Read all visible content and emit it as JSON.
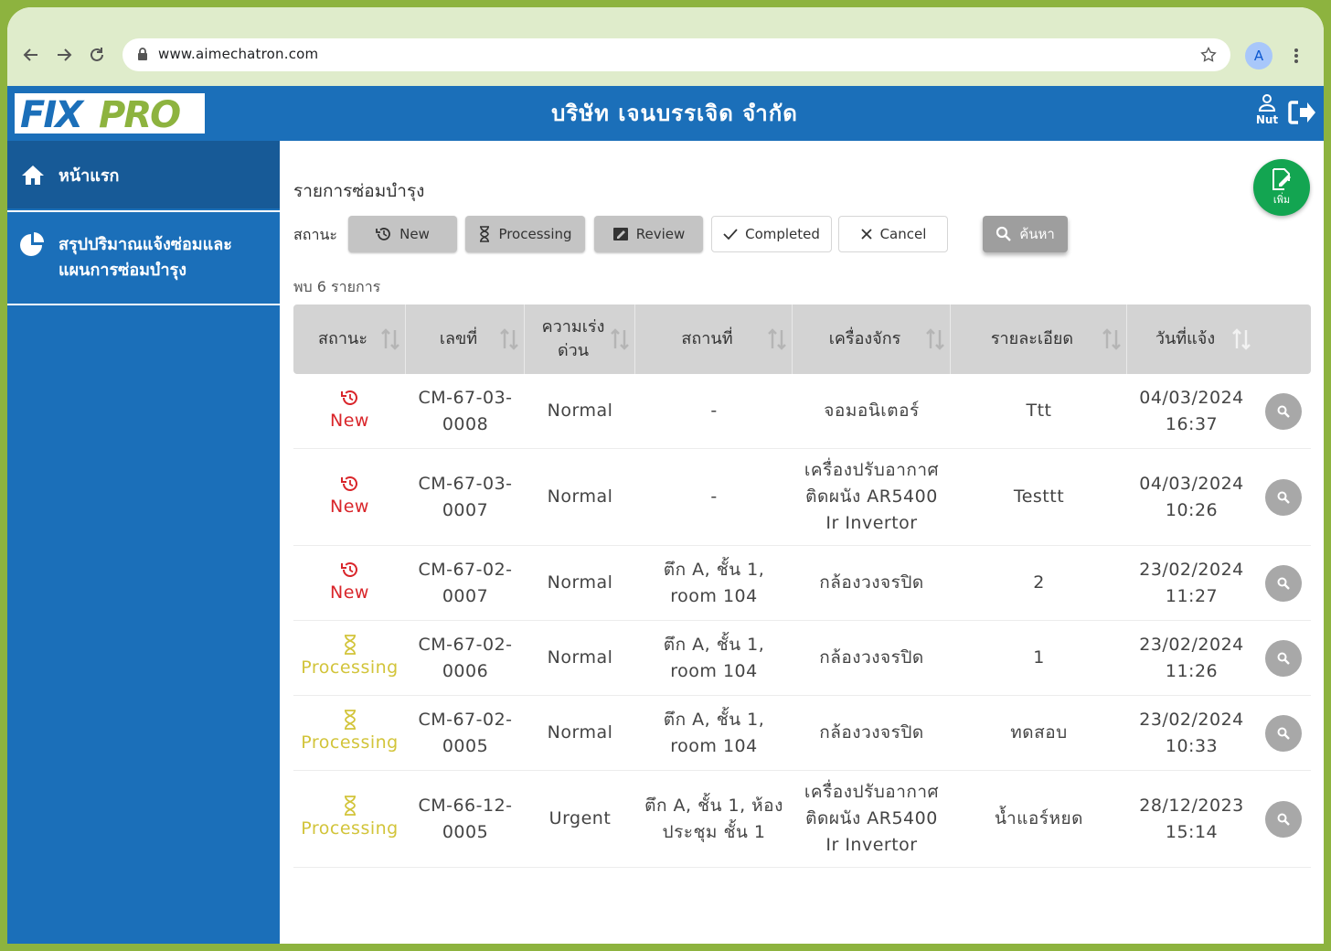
{
  "browser": {
    "url": "www.aimechatron.com",
    "profile_initial": "A"
  },
  "header": {
    "logo_text": "FIXPRO",
    "company": "บริษัท เจนบรรเจิด จำกัด",
    "user_name": "Nut"
  },
  "sidebar": {
    "items": [
      {
        "label": "หน้าแรก",
        "icon": "home-icon"
      },
      {
        "label_line1": "สรุปปริมาณแจ้งซ่อมและ",
        "label_line2": "แผนการซ่อมบำรุง",
        "icon": "pie-chart-icon"
      }
    ]
  },
  "main": {
    "title": "รายการซ่อมบำรุง",
    "status_label": "สถานะ",
    "filters": {
      "new": "New",
      "processing": "Processing",
      "review": "Review",
      "completed": "Completed",
      "cancel": "Cancel",
      "search": "ค้นหา"
    },
    "found_text": "พบ 6 รายการ",
    "add_label": "เพิ่ม",
    "columns": [
      "สถานะ",
      "เลขที่",
      "ความเร่งด่วน",
      "สถานที่",
      "เครื่องจักร",
      "รายละเอียด",
      "วันที่แจ้ง"
    ],
    "column_lines": {
      "urgency_line1": "ความเร่ง",
      "urgency_line2": "ด่วน"
    },
    "rows": [
      {
        "status": "New",
        "no1": "CM-67-03-",
        "no2": "0008",
        "urgency": "Normal",
        "loc1": "-",
        "loc2": "",
        "mach1": "จอมอนิเตอร์",
        "mach2": "",
        "mach3": "",
        "detail": "Ttt",
        "date": "04/03/2024",
        "time": "16:37"
      },
      {
        "status": "New",
        "no1": "CM-67-03-",
        "no2": "0007",
        "urgency": "Normal",
        "loc1": "-",
        "loc2": "",
        "mach1": "เครื่องปรับอากาศ",
        "mach2": "ติดผนัง AR5400",
        "mach3": "Ir Invertor",
        "detail": "Testtt",
        "date": "04/03/2024",
        "time": "10:26"
      },
      {
        "status": "New",
        "no1": "CM-67-02-",
        "no2": "0007",
        "urgency": "Normal",
        "loc1": "ตึก A, ชั้น 1,",
        "loc2": "room 104",
        "mach1": "กล้องวงจรปิด",
        "mach2": "",
        "mach3": "",
        "detail": "2",
        "date": "23/02/2024",
        "time": "11:27"
      },
      {
        "status": "Processing",
        "no1": "CM-67-02-",
        "no2": "0006",
        "urgency": "Normal",
        "loc1": "ตึก A, ชั้น 1,",
        "loc2": "room 104",
        "mach1": "กล้องวงจรปิด",
        "mach2": "",
        "mach3": "",
        "detail": "1",
        "date": "23/02/2024",
        "time": "11:26"
      },
      {
        "status": "Processing",
        "no1": "CM-67-02-",
        "no2": "0005",
        "urgency": "Normal",
        "loc1": "ตึก A, ชั้น 1,",
        "loc2": "room 104",
        "mach1": "กล้องวงจรปิด",
        "mach2": "",
        "mach3": "",
        "detail": "ทดสอบ",
        "date": "23/02/2024",
        "time": "10:33"
      },
      {
        "status": "Processing",
        "no1": "CM-66-12-",
        "no2": "0005",
        "urgency": "Urgent",
        "loc1": "ตึก A, ชั้น 1, ห้อง",
        "loc2": "ประชุม ชั้น 1",
        "mach1": "เครื่องปรับอากาศ",
        "mach2": "ติดผนัง AR5400",
        "mach3": "Ir Invertor",
        "detail": "น้ำแอร์หยด",
        "date": "28/12/2023",
        "time": "15:14"
      }
    ]
  },
  "colors": {
    "header_blue": "#1b6fb9",
    "new_red": "#d9252a",
    "processing_yellow": "#d2c43a",
    "add_green": "#13a551"
  }
}
